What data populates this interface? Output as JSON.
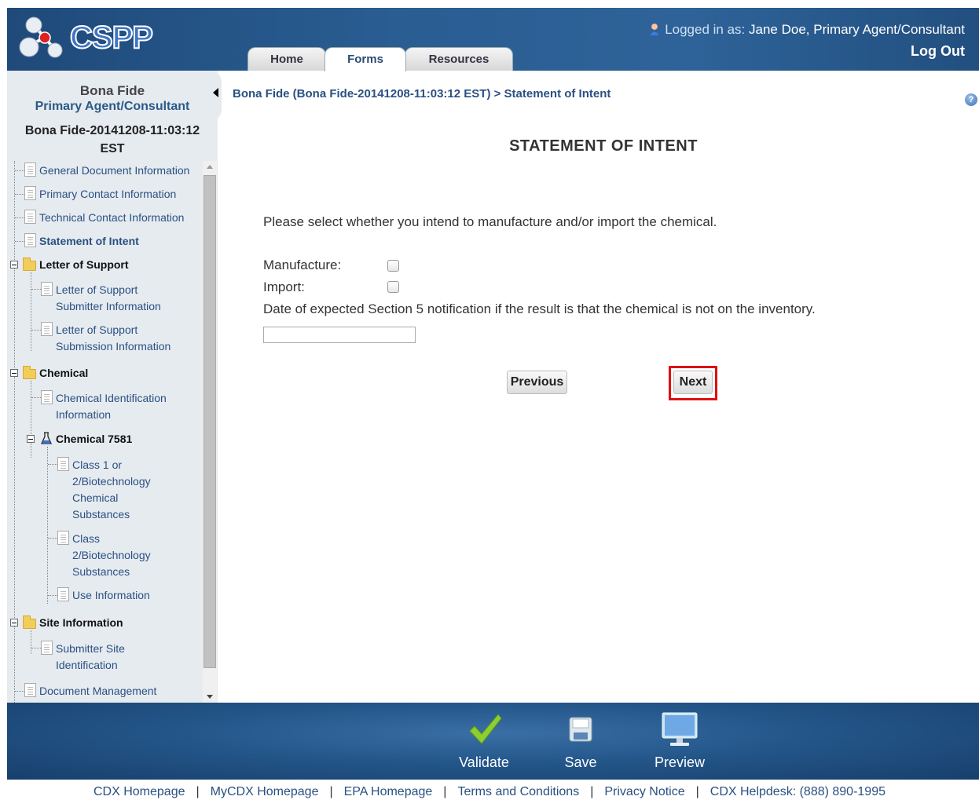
{
  "app": {
    "logo_text": "CSPP"
  },
  "header": {
    "tabs": [
      {
        "label": "Home"
      },
      {
        "label": "Forms"
      },
      {
        "label": "Resources"
      }
    ],
    "logged_in_prefix": "Logged in as:",
    "logged_in_user": "Jane Doe, Primary Agent/Consultant",
    "logout_label": "Log Out"
  },
  "sidebar": {
    "doc_type": "Bona Fide",
    "role": "Primary Agent/Consultant",
    "doc_id": "Bona Fide-20141208-11:03:12 EST",
    "tree": {
      "general": "General Document Information",
      "primary": "Primary Contact Information",
      "technical": "Technical Contact Information",
      "intent": "Statement of Intent",
      "los": "Letter of Support",
      "los_sub1": "Letter of Support",
      "los_sub2": "Submitter Information",
      "los_sub3": "Letter of Support",
      "los_sub4": "Submission Information",
      "chemical": "Chemical",
      "chem_id1": "Chemical Identification",
      "chem_id2": "Information",
      "chem7581": "Chemical 7581",
      "class1_a": "Class 1 or",
      "class1_b": "2/Biotechnology",
      "class1_c": "Chemical",
      "class1_d": "Substances",
      "class2_a": "Class",
      "class2_b": "2/Biotechnology",
      "class2_c": "Substances",
      "use": "Use Information",
      "site": "Site Information",
      "site_sub1": "Submitter Site",
      "site_sub2": "Identification",
      "docmgmt": "Document Management"
    }
  },
  "main": {
    "breadcrumb": "Bona Fide (Bona Fide-20141208-11:03:12 EST) > Statement of Intent",
    "title": "STATEMENT OF INTENT",
    "instruction": "Please select whether you intend to manufacture and/or import the chemical.",
    "manufacture_label": "Manufacture:",
    "import_label": "Import:",
    "date_label": "Date of expected Section 5 notification if the result is that the chemical is not on the inventory.",
    "date_value": "",
    "previous_label": "Previous",
    "next_label": "Next"
  },
  "toolbar": {
    "validate": "Validate",
    "save": "Save",
    "preview": "Preview"
  },
  "footer": {
    "links": [
      "CDX Homepage",
      "MyCDX Homepage",
      "EPA Homepage",
      "Terms and Conditions",
      "Privacy Notice",
      "CDX Helpdesk: (888) 890-1995"
    ]
  },
  "colors": {
    "header_blue": "#2a5d92",
    "link_blue": "#2a5082",
    "highlight_red": "#e01010",
    "checkmark_green": "#7cbf2a"
  }
}
